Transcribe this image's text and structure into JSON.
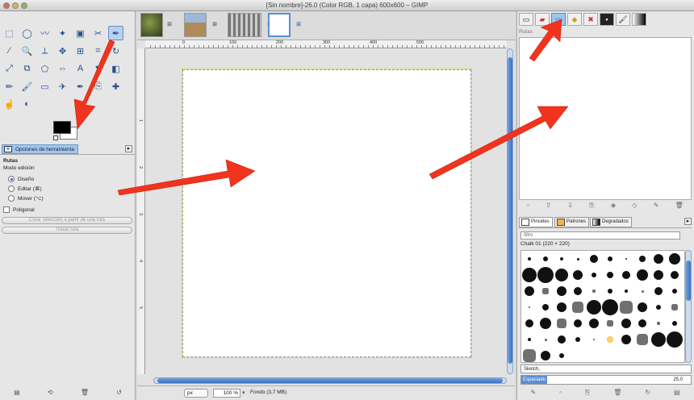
{
  "window": {
    "title": "[Sin nombre]-26.0 (Color RGB, 1 capa) 600x600 – GIMP"
  },
  "toolbox": {
    "tools": [
      "rect-select",
      "ellipse-select",
      "free-select",
      "fuzzy-select",
      "select-by-color",
      "scissors",
      "paths",
      "color-picker",
      "zoom",
      "measure",
      "move",
      "align",
      "crop",
      "rotate",
      "scale",
      "shear",
      "perspective",
      "flip",
      "text",
      "bucket-fill",
      "blend",
      "pencil",
      "paintbrush",
      "eraser",
      "airbrush",
      "ink",
      "clone",
      "heal",
      "smudge",
      "dodge-burn"
    ],
    "tool_glyphs": [
      "⬚",
      "◯",
      "〰",
      "✦",
      "▣",
      "✂",
      "✒",
      "⁄",
      "🔍",
      "⟂",
      "✥",
      "⊞",
      "⌗",
      "↻",
      "⤢",
      "⧉",
      "⬠",
      "⇔",
      "A",
      "▼",
      "◧",
      "✏",
      "🖌",
      "▭",
      "✈",
      "✒",
      "⎘",
      "✚",
      "☝",
      "◐"
    ],
    "selected_tool": 6,
    "dock_tab": "Opciones de herramienta",
    "options": {
      "title": "Rutas",
      "subtitle": "Modo edición",
      "modes": [
        "Diseño",
        "Editar (⌘)",
        "Mover (⌥)"
      ],
      "selected_mode": 0,
      "polygonal": "Poligonal",
      "btn_selection": "Crear selección a partir de una ruta",
      "btn_stroke": "Trazar ruta"
    }
  },
  "ruler": {
    "ticks": [
      "0",
      "100",
      "200",
      "300",
      "400",
      "500"
    ],
    "vticks": [
      "1",
      "2",
      "3",
      "4",
      "5"
    ]
  },
  "status": {
    "unit": "px",
    "zoom": "100 %",
    "info": "Fondo (3,7 MB)"
  },
  "rightdock": {
    "paths_label": "Rutas",
    "brush_tabs": [
      "Pinceles",
      "Patrones",
      "Degradados"
    ],
    "filter_placeholder": "filtro",
    "brush_name": "Chalk 01 (220 × 220)",
    "brush_text": "Sketch,",
    "spacing_label": "Espaciado",
    "spacing_value": "25,0",
    "spacing_fraction": 0.25
  }
}
